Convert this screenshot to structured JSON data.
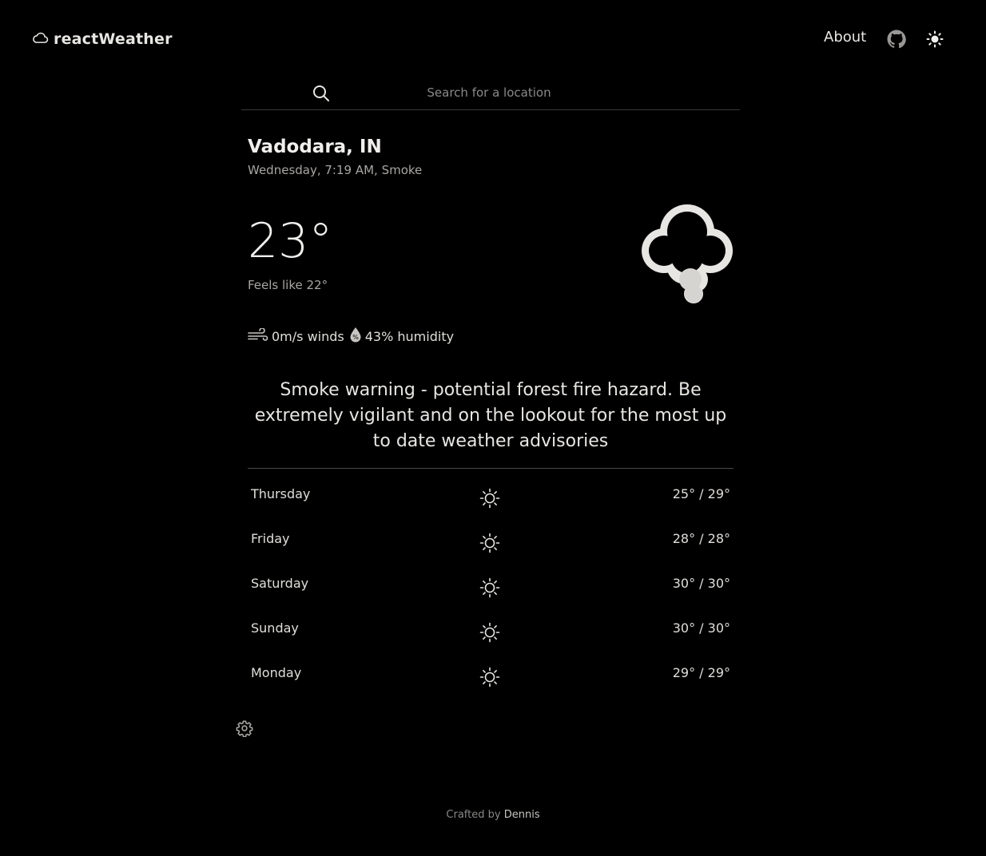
{
  "header": {
    "brand": "reactWeather",
    "nav_about": "About"
  },
  "search": {
    "placeholder": "Search for a location"
  },
  "current": {
    "location": "Vadodara, IN",
    "subline": "Wednesday, 7:19 AM, Smoke",
    "temperature": "23°",
    "feels_like": "Feels like 22°",
    "wind": "0m/s winds",
    "humidity": "43% humidity",
    "icon": "smoke-cloud-icon",
    "alert": "Smoke warning - potential forest fire hazard. Be extremely vigilant and on the lookout for the most up to date weather advisories"
  },
  "forecast": [
    {
      "day": "Thursday",
      "icon": "sun-icon",
      "range": "25° / 29°"
    },
    {
      "day": "Friday",
      "icon": "sun-icon",
      "range": "28° / 28°"
    },
    {
      "day": "Saturday",
      "icon": "sun-icon",
      "range": "30° / 30°"
    },
    {
      "day": "Sunday",
      "icon": "sun-icon",
      "range": "30° / 30°"
    },
    {
      "day": "Monday",
      "icon": "sun-icon",
      "range": "29° / 29°"
    }
  ],
  "footer": {
    "prefix": "Crafted by",
    "author": "Dennis"
  },
  "colors": {
    "background": "#000000",
    "text": "#e8e6e3",
    "muted": "#a8a6a3"
  }
}
